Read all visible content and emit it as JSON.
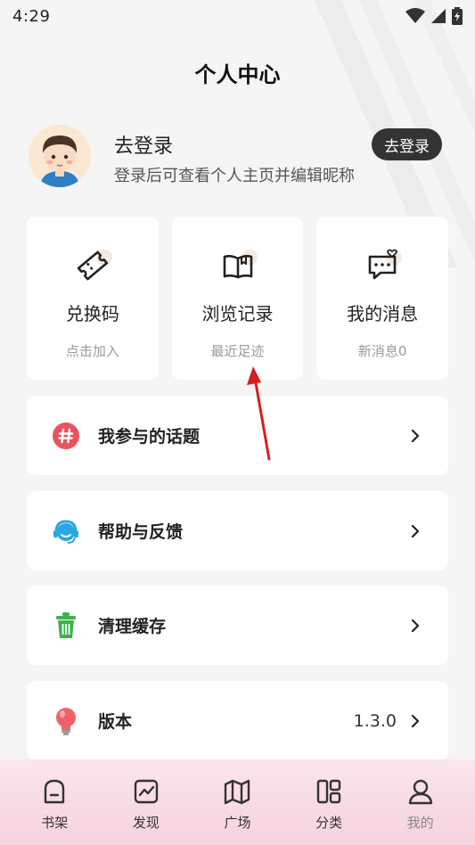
{
  "status_bar": {
    "time": "4:29"
  },
  "page": {
    "title": "个人中心"
  },
  "profile": {
    "name": "去登录",
    "subtitle": "登录后可查看个人主页并编辑昵称",
    "login_button": "去登录"
  },
  "cards": [
    {
      "title": "兑换码",
      "subtitle": "点击加入",
      "icon": "ticket-icon"
    },
    {
      "title": "浏览记录",
      "subtitle": "最近足迹",
      "icon": "book-icon"
    },
    {
      "title": "我的消息",
      "subtitle": "新消息0",
      "icon": "message-icon"
    }
  ],
  "menu": [
    {
      "label": "我参与的话题",
      "value": "",
      "icon": "hashtag-icon"
    },
    {
      "label": "帮助与反馈",
      "value": "",
      "icon": "headset-icon"
    },
    {
      "label": "清理缓存",
      "value": "",
      "icon": "trash-icon"
    },
    {
      "label": "版本",
      "value": "1.3.0",
      "icon": "lightbulb-icon"
    }
  ],
  "tabs": [
    {
      "label": "书架",
      "icon": "bookshelf-icon"
    },
    {
      "label": "发现",
      "icon": "trend-icon"
    },
    {
      "label": "广场",
      "icon": "map-icon"
    },
    {
      "label": "分类",
      "icon": "grid-icon"
    },
    {
      "label": "我的",
      "icon": "user-icon",
      "active": true
    }
  ],
  "colors": {
    "accent_red": "#e9545b",
    "headset_blue": "#2aa7e0",
    "trash_green": "#3fb24a",
    "dark_button": "#333333",
    "annotation_arrow": "#d81e1e"
  }
}
